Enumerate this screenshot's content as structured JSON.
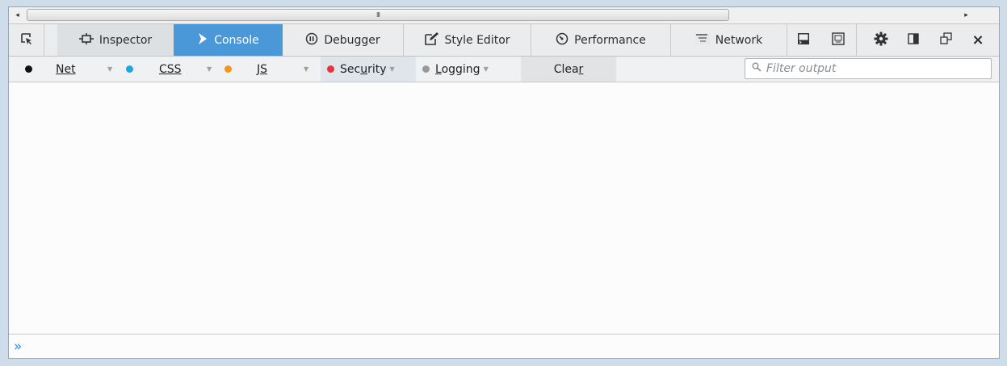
{
  "scrollbar": {
    "grip": "III",
    "left_arrow": "◂",
    "right_arrow": "▸"
  },
  "toolbar": {
    "pick_icon": "pick-element-icon",
    "tabs": [
      {
        "label": "Inspector",
        "icon": "inspector-icon",
        "glyph": "⊡"
      },
      {
        "label": "Console",
        "icon": "console-icon",
        "glyph": "❯",
        "selected": true
      },
      {
        "label": "Debugger",
        "icon": "debugger-icon",
        "glyph": "⓪"
      },
      {
        "label": "Style Editor",
        "icon": "style-editor-icon",
        "glyph": "✎"
      },
      {
        "label": "Performance",
        "icon": "performance-icon",
        "glyph": "◷"
      },
      {
        "label": "Network",
        "icon": "network-icon",
        "glyph": "≡"
      }
    ],
    "right_icons": [
      "split-console-icon",
      "scratchpad-icon",
      "settings-icon",
      "dock-side-icon",
      "undock-icon",
      "close-icon"
    ],
    "close_glyph": "×"
  },
  "filters": {
    "net": {
      "label": "Net",
      "color": "#111111"
    },
    "css": {
      "label": "CSS",
      "color": "#1ea7e1"
    },
    "js": {
      "label": "JS",
      "color": "#f7941d"
    },
    "security": {
      "label": "Security",
      "color": "#e8333b",
      "label_pre": "Sec",
      "label_u": "u",
      "label_post": "rity"
    },
    "logging": {
      "label": "Logging",
      "color": "#999999",
      "label_u": "L",
      "label_post": "ogging"
    },
    "clear": {
      "label": "Clear",
      "label_pre": "Clea",
      "label_u": "r"
    },
    "search_placeholder": "Filter output",
    "dropdown_glyph": "▼"
  },
  "input": {
    "prompt": "»",
    "value": ""
  },
  "colors": {
    "accent": "#4b98d8",
    "toolbar_bg": "#ebeced"
  }
}
